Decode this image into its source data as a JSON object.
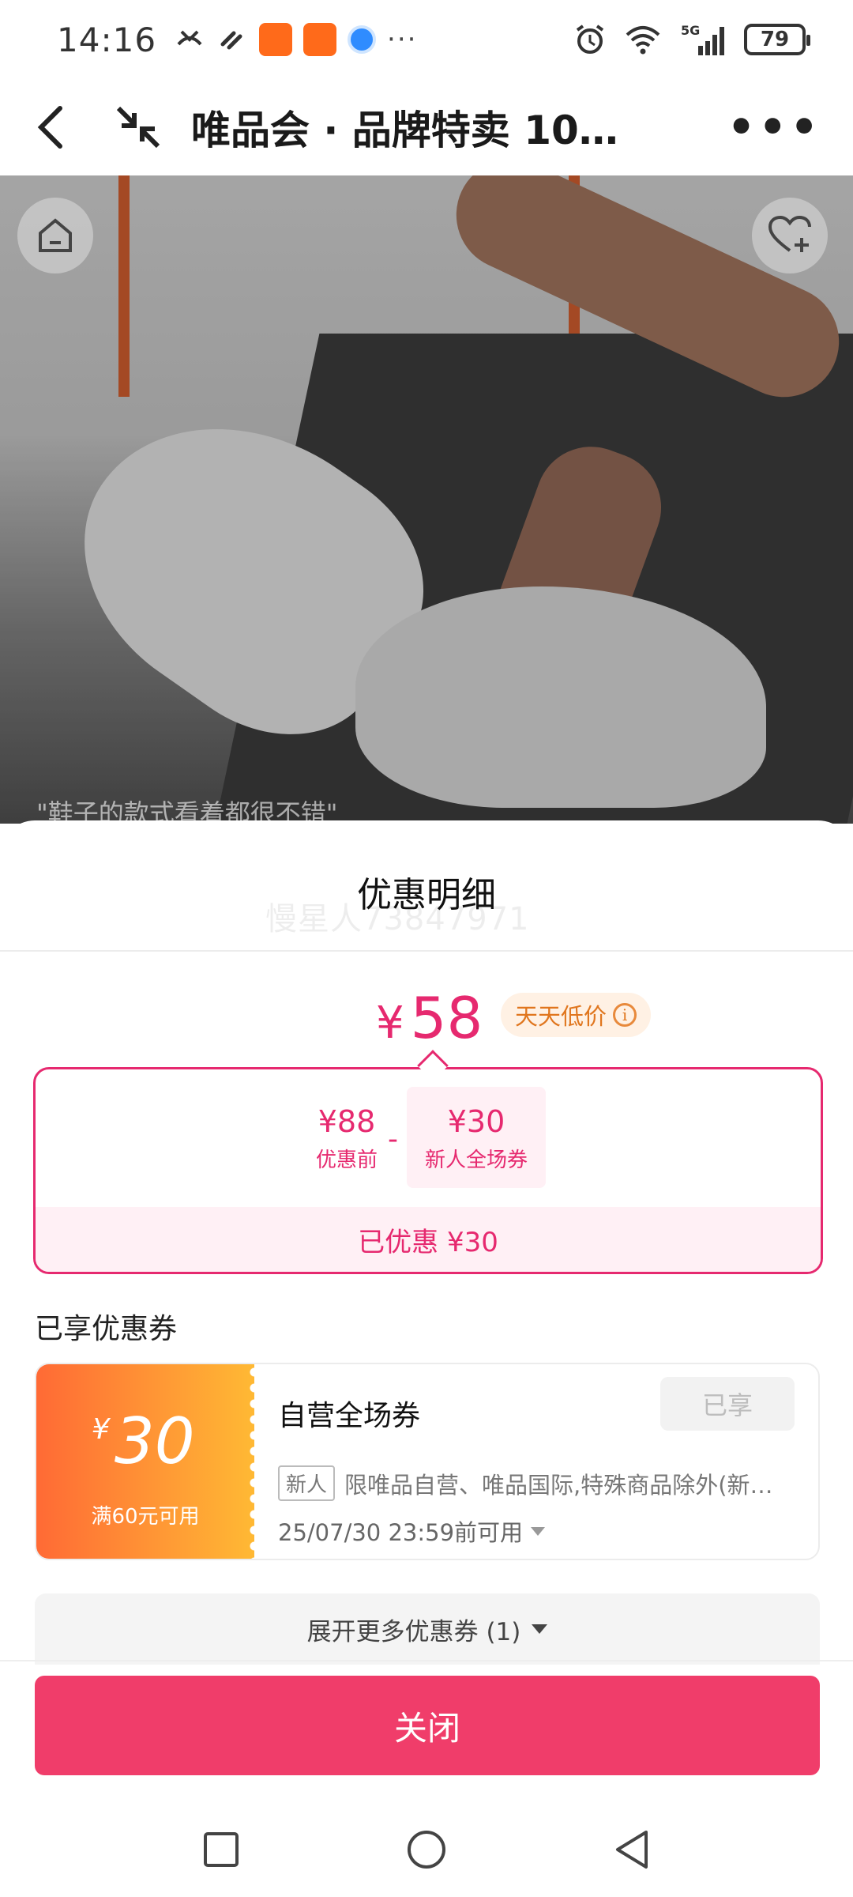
{
  "status_bar": {
    "time": "14:16",
    "overflow": "···",
    "battery": "79",
    "network": "5G"
  },
  "title_bar": {
    "title": "唯品会 · 品牌特卖 10…"
  },
  "hero": {
    "caption": "\"鞋子的款式看着都很不错\""
  },
  "sheet": {
    "title": "优惠明细",
    "watermark": "慢星人73847971",
    "final_price": {
      "currency": "¥",
      "amount": "58"
    },
    "daily_tag": "天天低价",
    "breakdown": {
      "original": {
        "value": "¥88",
        "label": "优惠前"
      },
      "operator": "-",
      "coupon": {
        "value": "¥30",
        "label": "新人全场券"
      },
      "total_saved": "已优惠 ¥30"
    },
    "section_label": "已享优惠券",
    "coupon": {
      "currency": "¥",
      "amount": "30",
      "condition": "满60元可用",
      "name": "自营全场券",
      "status": "已享",
      "tag": "新人",
      "description": "限唯品自营、唯品国际,特殊商品除外(新…",
      "expiry": "25/07/30 23:59前可用"
    },
    "expand_label": "展开更多优惠券 (1)",
    "close_label": "关闭"
  },
  "colors": {
    "accent": "#e6296f",
    "close_button": "#f03d6a",
    "coupon_gradient_start": "#ff6a35",
    "coupon_gradient_end": "#ffb934",
    "daily_tag_text": "#e0761e"
  }
}
